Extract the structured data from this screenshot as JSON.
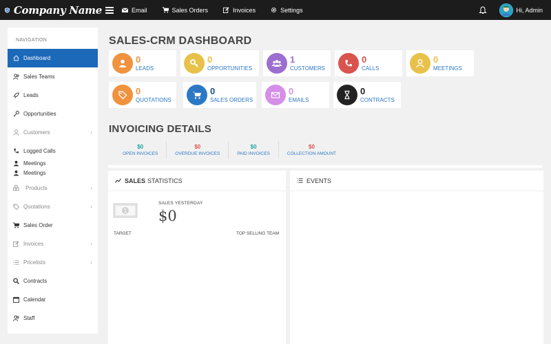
{
  "brand": {
    "name": "Company Name"
  },
  "topnav": [
    {
      "label": "Email",
      "icon": "envelope-icon"
    },
    {
      "label": "Sales Orders",
      "icon": "cart-icon"
    },
    {
      "label": "Invoices",
      "icon": "edit-icon"
    },
    {
      "label": "Settings",
      "icon": "gear-icon"
    }
  ],
  "user": {
    "label": "Hi, Admin"
  },
  "sidebar": {
    "heading": "NAVIGATION",
    "items": [
      {
        "label": "Dashboard",
        "icon": "home-icon"
      },
      {
        "label": "Sales Teams",
        "icon": "users-icon"
      },
      {
        "label": "Leads",
        "icon": "rocket-icon"
      },
      {
        "label": "Opportunities",
        "icon": "key-icon"
      },
      {
        "label": "Customers",
        "icon": "user-icon"
      },
      {
        "label": "Logged Calls",
        "icon": "phone-icon"
      },
      {
        "label": "Meetings",
        "icon": "user-icon"
      },
      {
        "label": "Meetings",
        "icon": "user-icon"
      },
      {
        "label": "Products",
        "icon": "cubes-icon"
      },
      {
        "label": "Quotations",
        "icon": "tag-icon"
      },
      {
        "label": "Sales Order",
        "icon": "cart-icon"
      },
      {
        "label": "Invoices",
        "icon": "edit-icon"
      },
      {
        "label": "Pricelists",
        "icon": "list-icon"
      },
      {
        "label": "Contracts",
        "icon": "search-icon"
      },
      {
        "label": "Calendar",
        "icon": "calendar-icon"
      },
      {
        "label": "Staff",
        "icon": "users-icon"
      }
    ]
  },
  "dashboard": {
    "title": "SALES-CRM DASHBOARD",
    "cards": [
      {
        "value": "0",
        "label": "LEADS",
        "color": "#f0923e",
        "icon": "user-icon"
      },
      {
        "value": "0",
        "label": "OPPORTUNITIES",
        "color": "#e8c14a",
        "icon": "key-icon"
      },
      {
        "value": "1",
        "label": "CUSTOMERS",
        "color": "#9b6fcf",
        "icon": "users-icon"
      },
      {
        "value": "0",
        "label": "CALLS",
        "color": "#d9534f",
        "icon": "phone-icon"
      },
      {
        "value": "0",
        "label": "MEETINGS",
        "color": "#e8c14a",
        "icon": "user-icon"
      },
      {
        "value": "0",
        "label": "QUOTATIONS",
        "color": "#f0923e",
        "icon": "tag-icon"
      },
      {
        "value": "0",
        "label": "SALES ORDERS",
        "color": "#2c78c5",
        "icon": "cart-icon"
      },
      {
        "value": "0",
        "label": "EMAILS",
        "color": "#d58fe8",
        "icon": "envelope-icon"
      },
      {
        "value": "0",
        "label": "CONTRACTS",
        "color": "#222222",
        "icon": "hourglass-icon"
      }
    ]
  },
  "invoicing": {
    "title": "INVOICING DETAILS",
    "items": [
      {
        "value": "$0",
        "label": "OPEN INVOICES",
        "color": "#1aa3a3"
      },
      {
        "value": "$0",
        "label": "OVERDUE INVOICES",
        "color": "#d9534f"
      },
      {
        "value": "$0",
        "label": "PAID INVOICES",
        "color": "#1aa3a3"
      },
      {
        "value": "$0",
        "label": "COLLECTION AMOUNT",
        "color": "#d9534f"
      }
    ]
  },
  "sales_stats": {
    "title_bold": "SALES",
    "title_rest": "STATISTICS",
    "caption": "SALES YESTERDAY",
    "value": "$0",
    "target_label": "TARGET",
    "team_label": "TOP SELLING TEAM"
  },
  "events": {
    "title": "EVENTS"
  }
}
